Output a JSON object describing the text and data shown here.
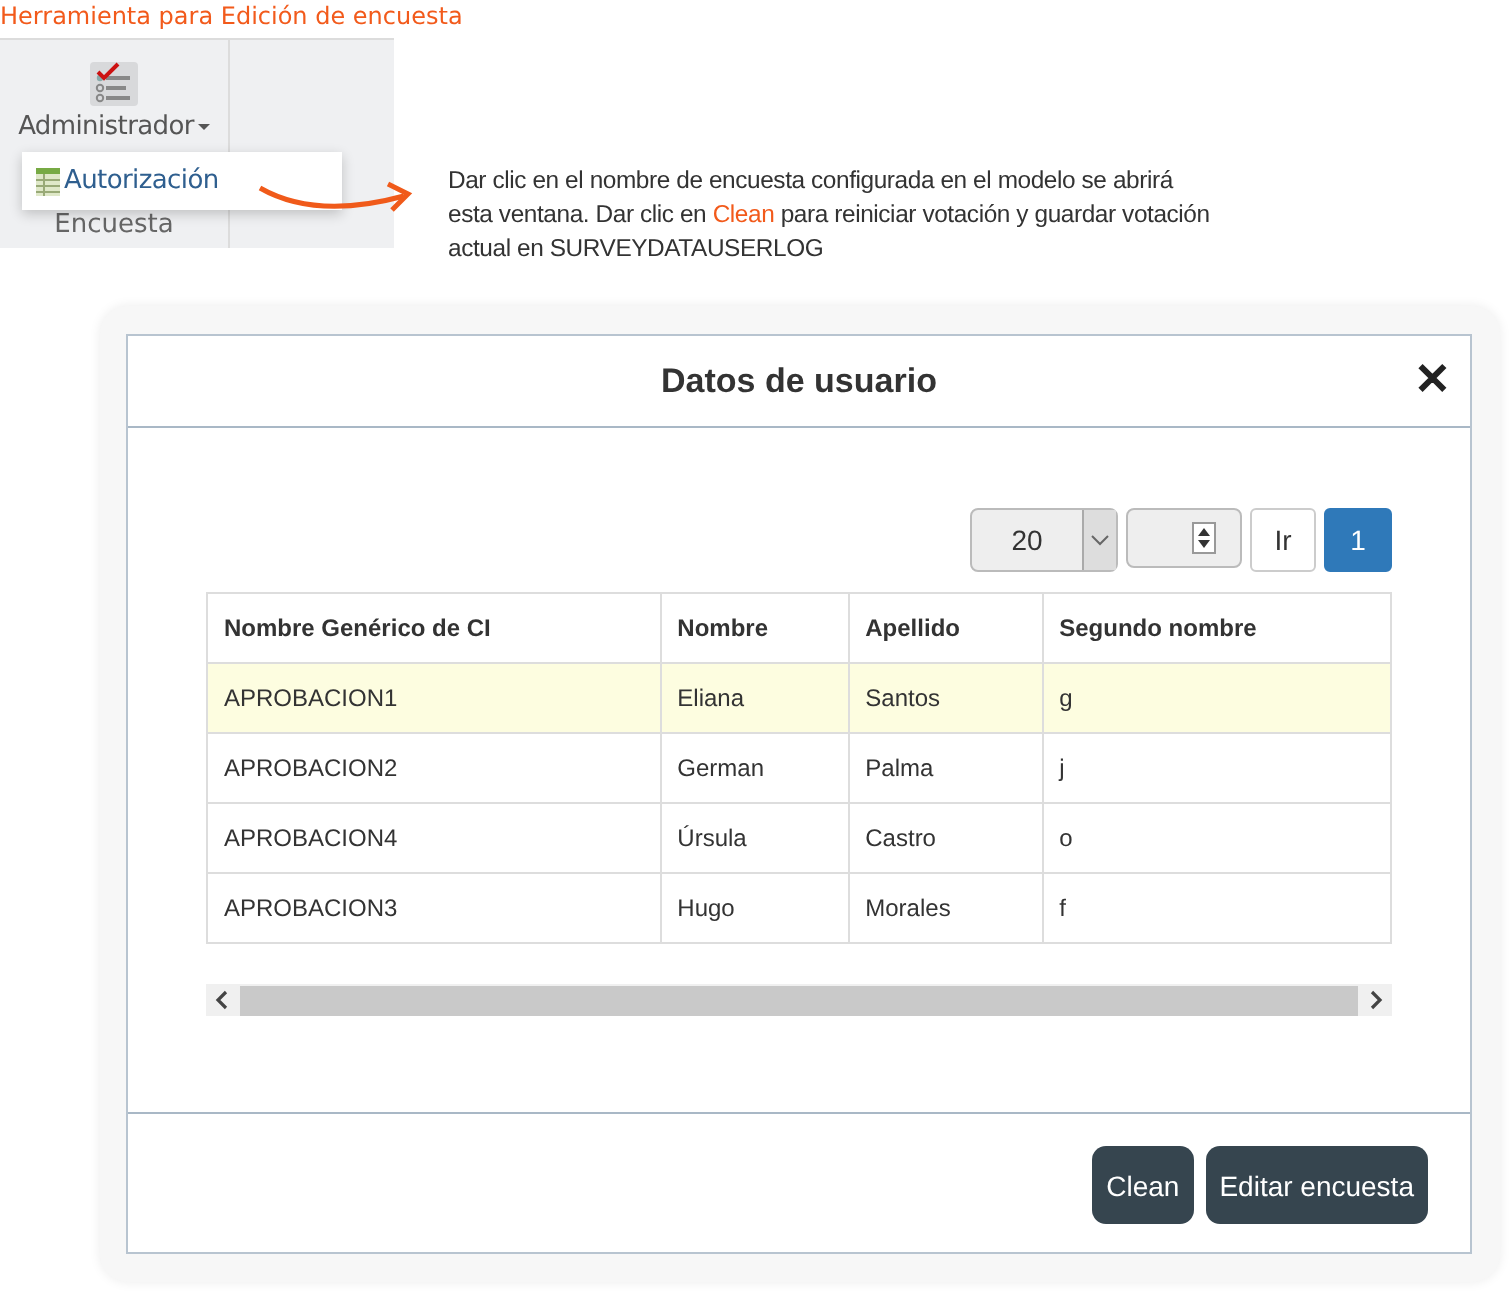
{
  "heading": "Herramienta para Edición de encuesta",
  "toolbar": {
    "button_label": "Administrador",
    "under_label": "Encuesta",
    "menu_items": [
      {
        "label": "Autorización"
      }
    ]
  },
  "note": "Dar clic en el nombre de encuesta configurada en el modelo se abrirá esta ventana. Dar clic en **Clean** para reiniciar votación y guardar votación actual en SURVEYDATAUSERLOG",
  "dialog": {
    "title": "Datos de usuario",
    "close": "✕",
    "pager": {
      "page_size": "20",
      "go_label": "Ir",
      "pages": [
        {
          "label": "1",
          "selected": true
        }
      ]
    },
    "table": {
      "columns": [
        "Nombre Genérico de CI",
        "Nombre",
        "Apellido",
        "Segundo nombre"
      ],
      "rows": [
        {
          "cells": [
            "APROBACION1",
            "Eliana",
            "Santos",
            "g"
          ],
          "selected": true
        },
        {
          "cells": [
            "APROBACION2",
            "German",
            "Palma",
            "j"
          ],
          "selected": false
        },
        {
          "cells": [
            "APROBACION4",
            "Úrsula",
            "Castro",
            "o"
          ],
          "selected": false
        },
        {
          "cells": [
            "APROBACION3",
            "Hugo",
            "Morales",
            "f"
          ],
          "selected": false
        }
      ]
    },
    "buttons": [
      "Clean",
      "Editar encuesta"
    ]
  }
}
